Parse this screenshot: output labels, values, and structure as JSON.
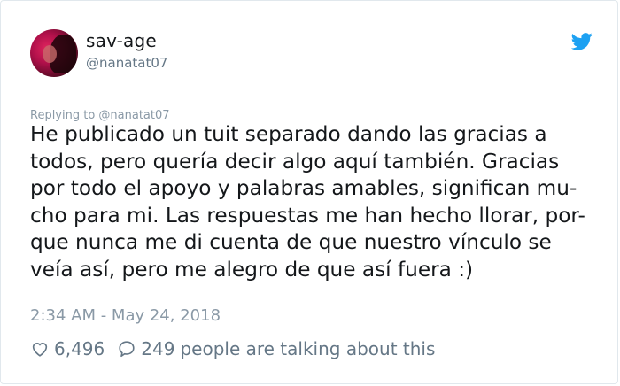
{
  "user": {
    "display_name": "sav-age",
    "handle": "@nanatat07"
  },
  "tweet": {
    "replying_to": "Replying to @nanatat07",
    "lines": [
      "He publicado un tuit separado dando las gracias a",
      "todos, pero quería decir algo aquí también. Gracias",
      "por todo el apoyo y palabras amables, significan mu-",
      "cho para mi. Las respuestas me han hecho llorar, por-",
      "que nunca me di cuenta de que nuestro vínculo se",
      "veía así, pero me alegro de que así fuera :)"
    ],
    "timestamp": "2:34 AM - May 24, 2018"
  },
  "actions": {
    "likes": "6,496",
    "replies": "249",
    "talking_text": "people are talking about this"
  },
  "colors": {
    "twitter_blue": "#1da1f2",
    "secondary_text": "#657786"
  },
  "icons": {
    "brand": "twitter-bird-icon",
    "like": "heart-icon",
    "reply": "speech-bubble-icon"
  }
}
